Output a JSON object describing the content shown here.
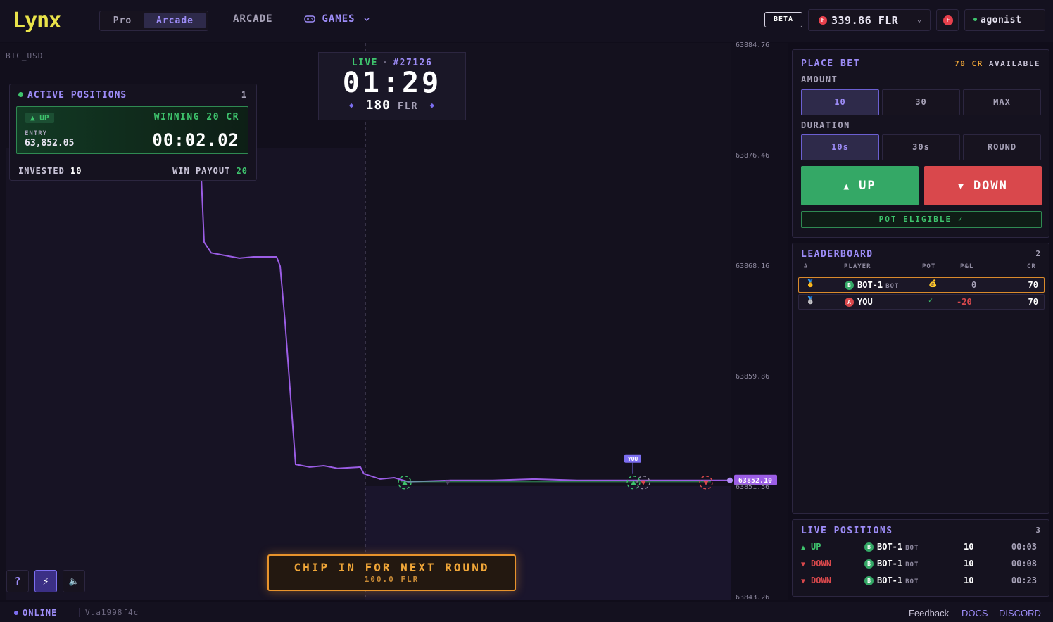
{
  "header": {
    "logo": "Lynx",
    "mode_pro": "Pro",
    "mode_arcade": "Arcade",
    "nav_arcade": "ARCADE",
    "nav_games": "GAMES",
    "beta": "BETA",
    "balance": "339.86 FLR",
    "coin_letter": "F",
    "username": "agonist"
  },
  "chart": {
    "pair": "BTC_USD",
    "y_ticks": [
      "63884.76",
      "63876.46",
      "63868.16",
      "63859.86",
      "63851.56",
      "63843.26"
    ],
    "current_price": "63852.10",
    "marker_you": "YOU"
  },
  "chart_data": {
    "type": "line",
    "title": "",
    "xlabel": "",
    "ylabel": "",
    "ylim": [
      63843.26,
      63884.76
    ],
    "series": [
      {
        "name": "",
        "values": [
          63878.5,
          63870.0,
          63869.2,
          63868.8,
          63868.9,
          63868.9,
          63868.9,
          63868.2,
          63864.0,
          63859.0,
          63853.3,
          63853.1,
          63853.2,
          63853.0,
          63853.1,
          63852.6,
          63852.2,
          63852.3,
          63852.0,
          63852.1,
          63852.1,
          63852.2,
          63852.1,
          63852.1,
          63852.1,
          63852.1
        ]
      }
    ]
  },
  "active_positions": {
    "title": "ACTIVE POSITIONS",
    "count": "1",
    "direction": "UP",
    "status": "WINNING 20 CR",
    "entry_label": "ENTRY",
    "entry_value": "63,852.05",
    "timer": "00:02.02",
    "invested_label": "INVESTED",
    "invested_value": "10",
    "payout_label": "WIN PAYOUT",
    "payout_value": "20"
  },
  "round": {
    "live": "LIVE",
    "round_no": "#27126",
    "time": "01:29",
    "pot": "180",
    "unit": "FLR"
  },
  "chip_in": {
    "title": "CHIP IN FOR NEXT ROUND",
    "amount": "100.0 FLR"
  },
  "toolbar": {
    "help": "?",
    "flash": "⚡",
    "sound": "🔈"
  },
  "place_bet": {
    "title": "PLACE BET",
    "available_value": "70 CR",
    "available_label": "AVAILABLE",
    "amount_label": "AMOUNT",
    "amounts": [
      "10",
      "30",
      "MAX"
    ],
    "duration_label": "DURATION",
    "durations": [
      "10s",
      "30s",
      "ROUND"
    ],
    "up_label": "UP",
    "down_label": "DOWN",
    "pot_eligible": "POT ELIGIBLE ✓"
  },
  "leaderboard": {
    "title": "LEADERBOARD",
    "count": "2",
    "headers": [
      "#",
      "PLAYER",
      "POT",
      "P&L",
      "CR"
    ],
    "rows": [
      {
        "rank": "🥇",
        "avatar": "B",
        "player": "BOT-1",
        "tag": "BOT",
        "pot": "💰",
        "pnl": "0",
        "cr": "70"
      },
      {
        "rank": "🥈",
        "avatar": "A",
        "player": "YOU",
        "tag": "",
        "pot": "✓",
        "pnl": "-20",
        "cr": "70"
      }
    ]
  },
  "live_positions": {
    "title": "LIVE POSITIONS",
    "count": "3",
    "rows": [
      {
        "dir": "UP",
        "avatar": "B",
        "player": "BOT-1",
        "tag": "BOT",
        "amount": "10",
        "time": "00:03"
      },
      {
        "dir": "DOWN",
        "avatar": "B",
        "player": "BOT-1",
        "tag": "BOT",
        "amount": "10",
        "time": "00:08"
      },
      {
        "dir": "DOWN",
        "avatar": "B",
        "player": "BOT-1",
        "tag": "BOT",
        "amount": "10",
        "time": "00:23"
      }
    ]
  },
  "footer": {
    "status": "ONLINE",
    "version": "V.a1998f4c",
    "feedback": "Feedback",
    "docs": "DOCS",
    "discord": "DISCORD"
  },
  "colors": {
    "accent": "#9d8cf7",
    "line": "#9b5de5",
    "up": "#34a866",
    "down": "#d9484c",
    "gold": "#f0a638",
    "logo": "#e9e34a"
  }
}
